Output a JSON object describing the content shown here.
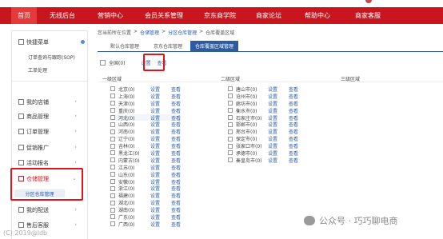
{
  "nav": {
    "items": [
      {
        "label": "首页",
        "active": true
      },
      {
        "label": "无线后台"
      },
      {
        "label": "营销中心"
      },
      {
        "label": "会员关系管理"
      },
      {
        "label": "京东商学院"
      },
      {
        "label": "商家论坛"
      },
      {
        "label": "帮助中心"
      },
      {
        "label": "商家客服"
      }
    ]
  },
  "sidebar": {
    "quick_menu": "快捷菜单",
    "quick_items": [
      "订单查询与跟踪(SOP)",
      "工单处理"
    ],
    "items": [
      {
        "label": "我的店铺"
      },
      {
        "label": "商品管理"
      },
      {
        "label": "订单管理"
      },
      {
        "label": "促销推广"
      },
      {
        "label": "活动报名"
      },
      {
        "label": "仓储管理",
        "highlight": true
      },
      {
        "label": "我的配送"
      },
      {
        "label": "售后客服"
      }
    ],
    "active_sub": "分区仓库管理"
  },
  "breadcrumb": {
    "prefix": "您当前所在位置",
    "sep": ">",
    "links": [
      "仓储管理",
      "分区仓库管理"
    ],
    "current": "仓库覆盖区域"
  },
  "tabs": [
    "默认仓库管理",
    "京东仓库管理",
    "仓库覆盖区域管理"
  ],
  "national": {
    "label": "全国",
    "suffix": "(0)",
    "set": "设置",
    "view": "查看"
  },
  "region_heads": [
    "一级区域",
    "二级区域",
    "三级区域"
  ],
  "level1": [
    {
      "name": "北京(0)"
    },
    {
      "name": "上海(0)"
    },
    {
      "name": "天津(0)"
    },
    {
      "name": "重庆(0)"
    },
    {
      "name": "河北(0)"
    },
    {
      "name": "山西(0)"
    },
    {
      "name": "河南(0)"
    },
    {
      "name": "辽宁(0)"
    },
    {
      "name": "吉林(0)"
    },
    {
      "name": "黑龙江(0)"
    },
    {
      "name": "内蒙古(0)"
    },
    {
      "name": "江苏(0)"
    },
    {
      "name": "山东(0)"
    },
    {
      "name": "安徽(0)"
    },
    {
      "name": "浙江(0)"
    },
    {
      "name": "福建(0)"
    },
    {
      "name": "湖北(0)"
    },
    {
      "name": "湖南(0)"
    },
    {
      "name": "广东(0)"
    },
    {
      "name": "广西(0)"
    }
  ],
  "level2": [
    {
      "name": "唐山市(0)"
    },
    {
      "name": "沧州市(0)"
    },
    {
      "name": "廊坊市(0)"
    },
    {
      "name": "衡水市(0)"
    },
    {
      "name": "石家庄市(0)"
    },
    {
      "name": "邯郸市(0)"
    },
    {
      "name": "邢台市(0)"
    },
    {
      "name": "保定市(0)"
    },
    {
      "name": "张家口市(0)"
    },
    {
      "name": "承德市(0)"
    },
    {
      "name": "秦皇岛市(0)"
    }
  ],
  "actions": {
    "set": "设置",
    "view": "查看"
  },
  "watermark": "公众号 · 巧巧聊电商",
  "corner_watermark": "(C) 2019@ldb",
  "colors": {
    "nav_bg": "#c9151e",
    "tab_active": "#2e5a9f",
    "link": "#2b5ea7",
    "highlight_box": "#e0141e"
  }
}
